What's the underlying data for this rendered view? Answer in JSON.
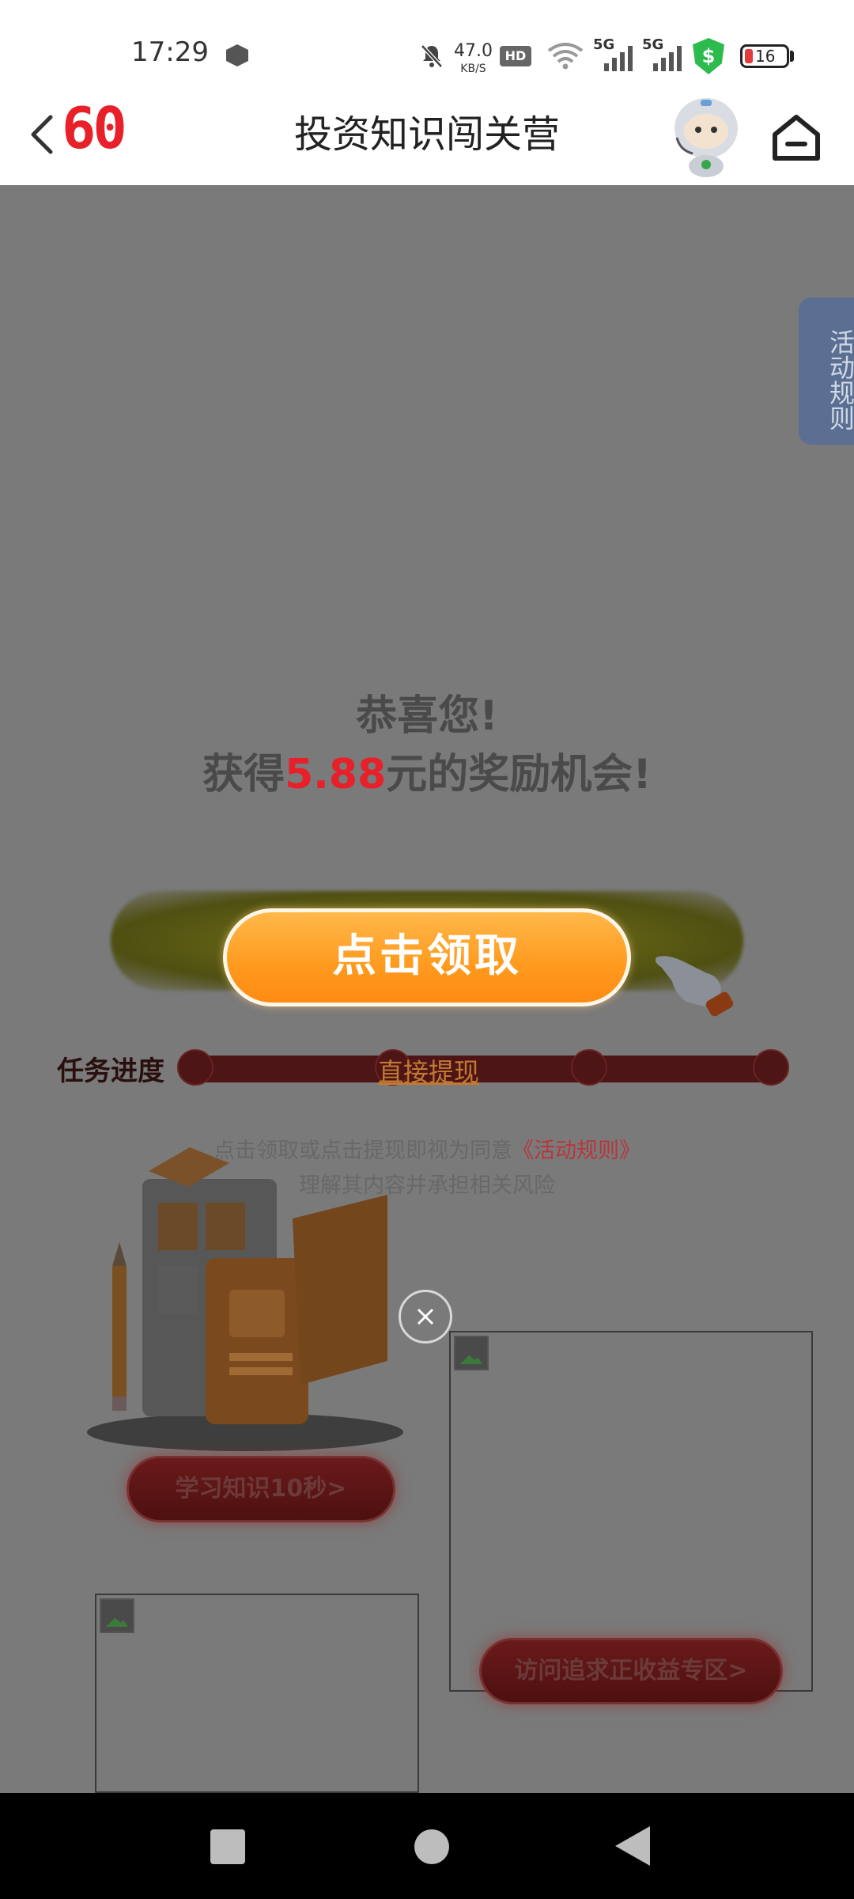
{
  "status_bar": {
    "time": "17:29",
    "net_speed_value": "47.0",
    "net_speed_unit": "KB/S",
    "hd_label": "HD",
    "signal1_label": "5G",
    "signal2_label": "5G",
    "shield_symbol": "$",
    "battery_level": "16"
  },
  "nav": {
    "logo_text": "60",
    "title": "投资知识闯关营"
  },
  "side_tab": {
    "label": "活动规则"
  },
  "reward": {
    "line1": "恭喜您!",
    "line2_prefix": "获得",
    "amount": "5.88",
    "line2_suffix": "元的奖励机会!",
    "claim_button": "点击领取"
  },
  "progress": {
    "label": "任务进度",
    "withdraw_link": "直接提现"
  },
  "consent": {
    "line1_prefix": "点击领取或点击提现即视为同意",
    "rules_link": "《活动规则》",
    "line2": "理解其内容并承担相关风险"
  },
  "buttons": {
    "learn": "学习知识10秒>",
    "visit": "访问追求正收益专区>"
  },
  "icons": {
    "back": "chevron-left-icon",
    "home": "home-icon",
    "close": "close-icon"
  },
  "colors": {
    "accent_red": "#e8202a",
    "claim_orange": "#ff9a1e",
    "overlay": "rgba(0,0,0,0.52)"
  }
}
